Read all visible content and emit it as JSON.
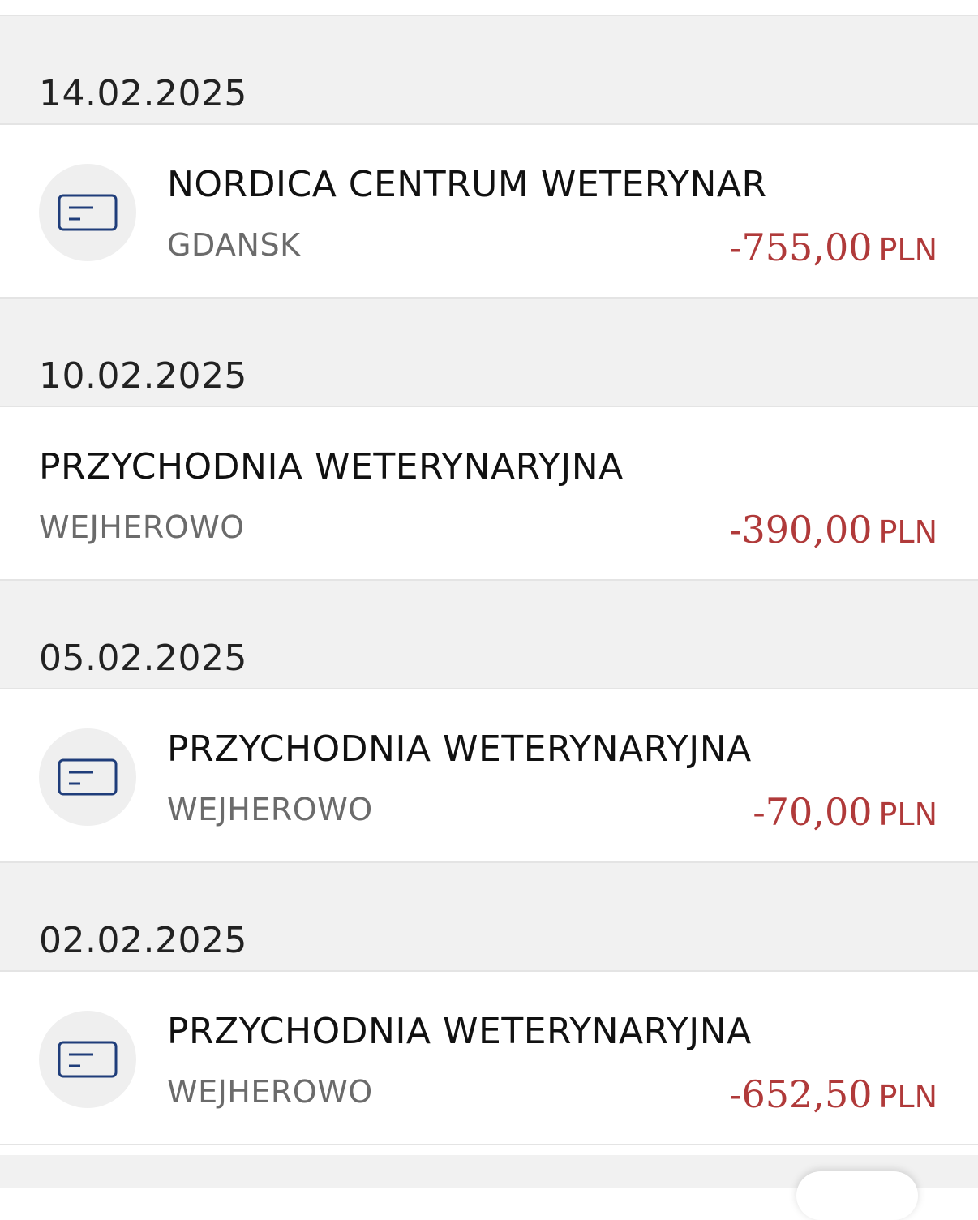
{
  "transactions_list": {
    "groups": [
      {
        "date": "14.02.2025",
        "transaction": {
          "merchant": "NORDICA CENTRUM WETERYNAR",
          "city": "GDANSK",
          "amount": "-755,00",
          "currency": "PLN",
          "icon": "card-icon"
        }
      },
      {
        "date": "10.02.2025",
        "transaction": {
          "merchant": "PRZYCHODNIA WETERYNARYJNA",
          "city": "WEJHEROWO",
          "amount": "-390,00",
          "currency": "PLN"
        }
      },
      {
        "date": "05.02.2025",
        "transaction": {
          "merchant": "PRZYCHODNIA WETERYNARYJNA",
          "city": "WEJHEROWO",
          "amount": "-70,00",
          "currency": "PLN",
          "icon": "card-icon"
        }
      },
      {
        "date": "02.02.2025",
        "transaction": {
          "merchant": "PRZYCHODNIA WETERYNARYJNA",
          "city": "WEJHEROWO",
          "amount": "-652,50",
          "currency": "PLN",
          "icon": "card-icon"
        }
      }
    ]
  },
  "colors": {
    "negative_amount": "#b03a3a",
    "icon_stroke": "#1f3d7a",
    "header_bg": "#f1f1f1"
  }
}
